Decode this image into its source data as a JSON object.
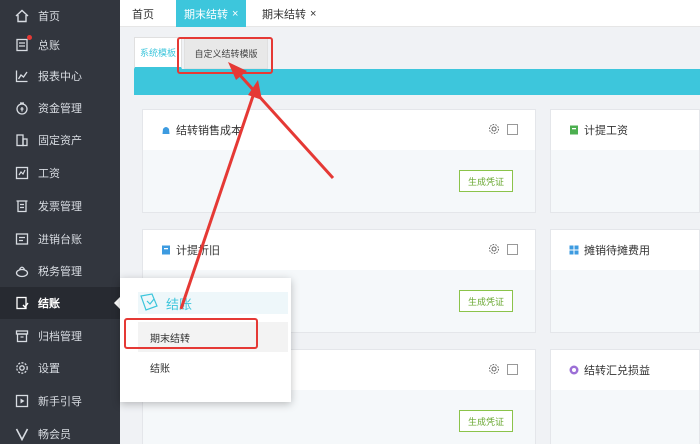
{
  "sidebar": {
    "items": [
      {
        "label": "首页",
        "icon": "home-icon"
      },
      {
        "label": "总账",
        "icon": "ledger-icon"
      },
      {
        "label": "报表中心",
        "icon": "report-chart-icon"
      },
      {
        "label": "资金管理",
        "icon": "money-bag-icon"
      },
      {
        "label": "固定资产",
        "icon": "building-icon"
      },
      {
        "label": "工资",
        "icon": "salary-icon"
      },
      {
        "label": "发票管理",
        "icon": "invoice-icon"
      },
      {
        "label": "进销台账",
        "icon": "inventory-icon"
      },
      {
        "label": "税务管理",
        "icon": "tax-icon"
      },
      {
        "label": "结账",
        "icon": "checkout-icon"
      },
      {
        "label": "归档管理",
        "icon": "archive-icon"
      },
      {
        "label": "设置",
        "icon": "gear-icon"
      },
      {
        "label": "新手引导",
        "icon": "play-guide-icon"
      },
      {
        "label": "畅会员",
        "icon": "vip-icon"
      }
    ],
    "active_index": 9
  },
  "tabs": {
    "home": "首页",
    "active": "期末结转",
    "second": "期末结转",
    "close": "×"
  },
  "subtabs": {
    "system": "系统模板",
    "custom": "自定义结转模版"
  },
  "cards": [
    {
      "title": "结转销售成本",
      "icon": "bag-icon",
      "button": "生成凭证"
    },
    {
      "title": "计提工资",
      "icon": "salary-doc-icon"
    },
    {
      "title": "计提折旧",
      "icon": "depreciation-icon",
      "button": "生成凭证"
    },
    {
      "title": "摊销待摊费用",
      "icon": "grid-icon"
    },
    {
      "title": "",
      "button": "生成凭证"
    },
    {
      "title": "结转汇兑损益",
      "icon": "exchange-icon"
    }
  ],
  "popup": {
    "title": "结账",
    "items": [
      "期末结转",
      "结账"
    ]
  },
  "colors": {
    "accent": "#3dc6dc",
    "sidebar_bg": "#32363e",
    "annotation": "#e53935",
    "button_border": "#8bc34a"
  }
}
